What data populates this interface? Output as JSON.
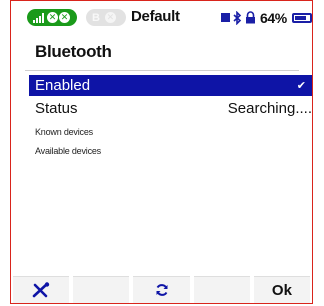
{
  "statusbar": {
    "model_name": "Default",
    "battery_percent": "64%",
    "battery_level": 0.64,
    "icons": [
      "signal-bars-icon",
      "bluetooth-icon",
      "lock-icon",
      "battery-icon"
    ]
  },
  "page": {
    "title": "Bluetooth"
  },
  "rows": {
    "enabled_label": "Enabled",
    "enabled_check": "✔",
    "status_label": "Status",
    "status_value": "Searching...."
  },
  "sections": {
    "known_devices": "Known devices",
    "available_devices": "Available devices"
  },
  "toolbar": {
    "ok_label": "Ok"
  },
  "colors": {
    "frame": "#d9241c",
    "accent": "#0e14a6",
    "pill_green": "#1a9a1a"
  }
}
